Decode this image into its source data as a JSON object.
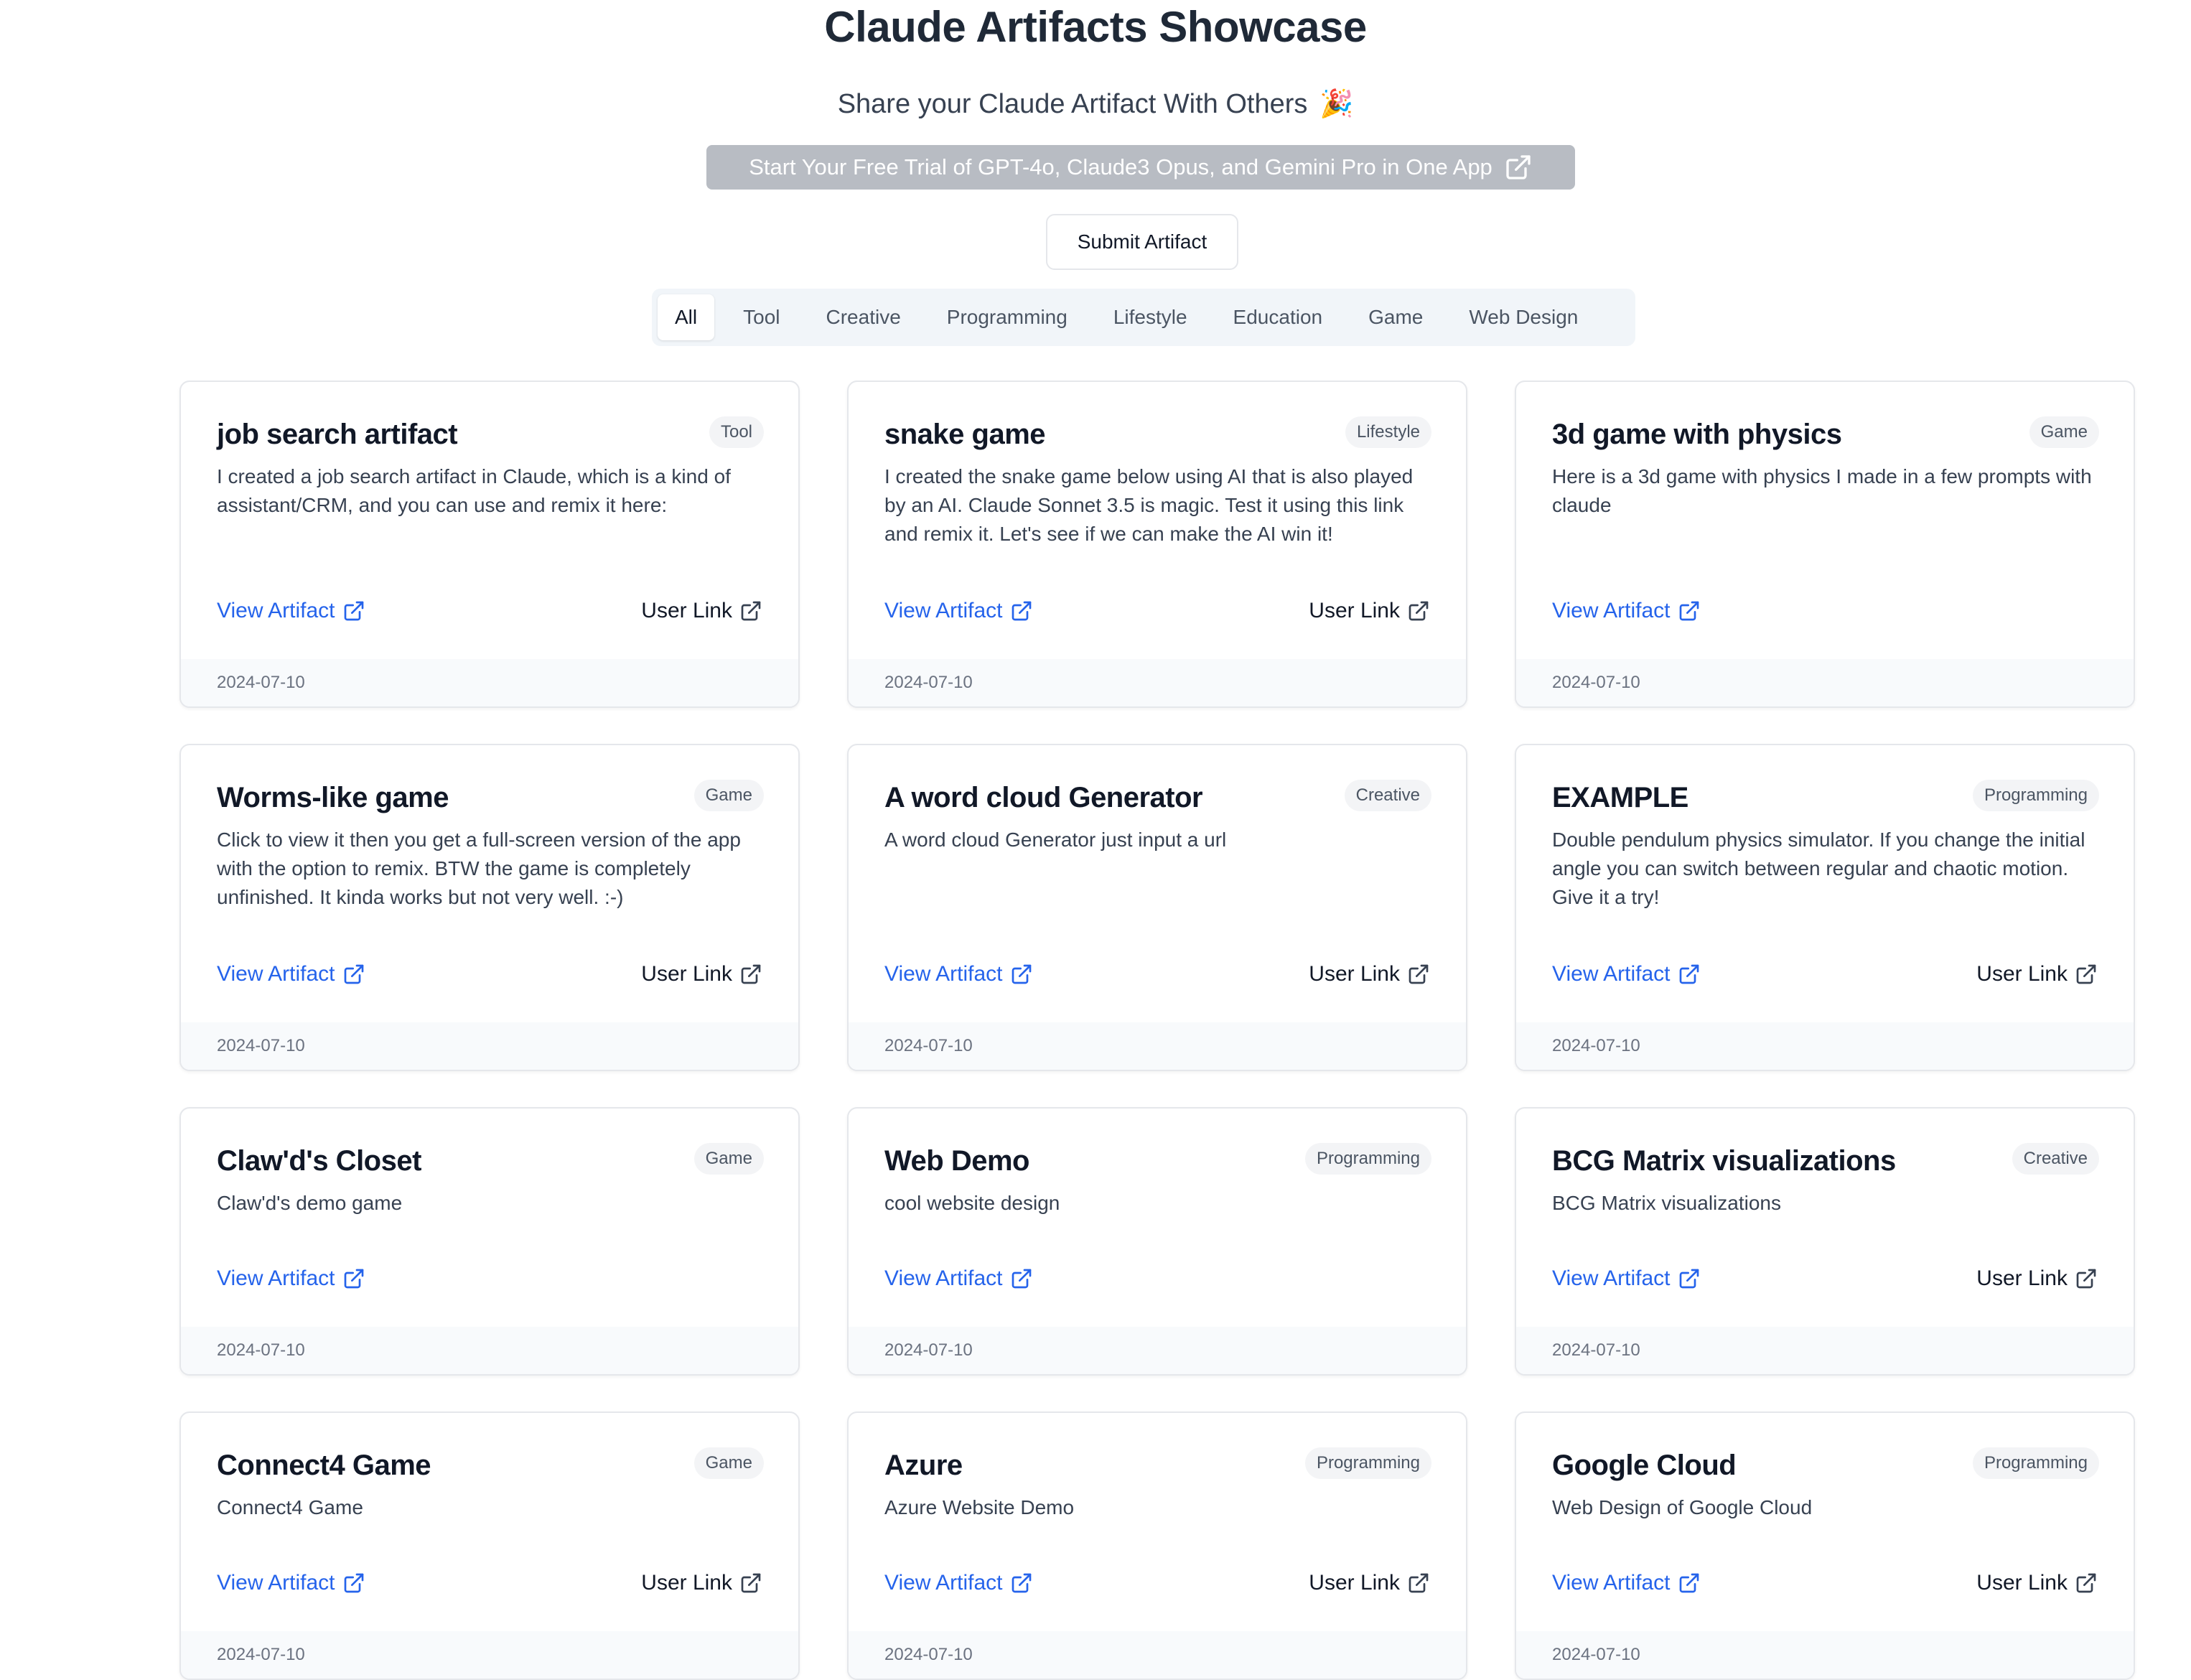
{
  "header": {
    "title": "Claude Artifacts Showcase",
    "subtitle": "Share your Claude Artifact With Others",
    "subtitle_emoji": "🎉",
    "promo_label": "Start Your Free Trial of GPT-4o, Claude3 Opus, and Gemini Pro in One App",
    "submit_label": "Submit Artifact"
  },
  "tabs": [
    "All",
    "Tool",
    "Creative",
    "Programming",
    "Lifestyle",
    "Education",
    "Game",
    "Web Design"
  ],
  "active_tab": "All",
  "link_labels": {
    "view": "View Artifact",
    "user": "User Link"
  },
  "colors": {
    "link_blue": "#2563eb",
    "promo_gray": "#b8bcc3",
    "tab_bg": "#f1f5f9"
  },
  "cards": [
    {
      "title": "job search artifact",
      "category": "Tool",
      "description": "I created a job search artifact in Claude, which is a kind of assistant/CRM, and you can use and remix it here:",
      "date": "2024-07-10",
      "has_user_link": true
    },
    {
      "title": "snake game",
      "category": "Lifestyle",
      "description": "I created the snake game below using AI that is also played by an AI. Claude Sonnet 3.5 is magic. Test it using this link and remix it. Let's see if we can make the AI win it!",
      "date": "2024-07-10",
      "has_user_link": true
    },
    {
      "title": "3d game with physics",
      "category": "Game",
      "description": "Here is a 3d game with physics I made in a few prompts with claude",
      "date": "2024-07-10",
      "has_user_link": false
    },
    {
      "title": "Worms-like game",
      "category": "Game",
      "description": "Click to view it then you get a full-screen version of the app with the option to remix. BTW the game is completely unfinished. It kinda works but not very well. :-)",
      "date": "2024-07-10",
      "has_user_link": true
    },
    {
      "title": "A word cloud Generator",
      "category": "Creative",
      "description": "A word cloud Generator just input a url",
      "date": "2024-07-10",
      "has_user_link": true
    },
    {
      "title": "EXAMPLE",
      "category": "Programming",
      "description": "Double pendulum physics simulator. If you change the initial angle you can switch between regular and chaotic motion. Give it a try!",
      "date": "2024-07-10",
      "has_user_link": true
    },
    {
      "title": "Claw'd's Closet",
      "category": "Game",
      "description": "Claw'd's demo game",
      "date": "2024-07-10",
      "has_user_link": false
    },
    {
      "title": "Web Demo",
      "category": "Programming",
      "description": "cool website design",
      "date": "2024-07-10",
      "has_user_link": false
    },
    {
      "title": "BCG Matrix visualizations",
      "category": "Creative",
      "description": "BCG Matrix visualizations",
      "date": "2024-07-10",
      "has_user_link": true
    },
    {
      "title": "Connect4 Game",
      "category": "Game",
      "description": "Connect4 Game",
      "date": "2024-07-10",
      "has_user_link": true
    },
    {
      "title": "Azure",
      "category": "Programming",
      "description": "Azure Website Demo",
      "date": "2024-07-10",
      "has_user_link": true
    },
    {
      "title": "Google Cloud",
      "category": "Programming",
      "description": "Web Design of Google Cloud",
      "date": "2024-07-10",
      "has_user_link": true
    }
  ]
}
